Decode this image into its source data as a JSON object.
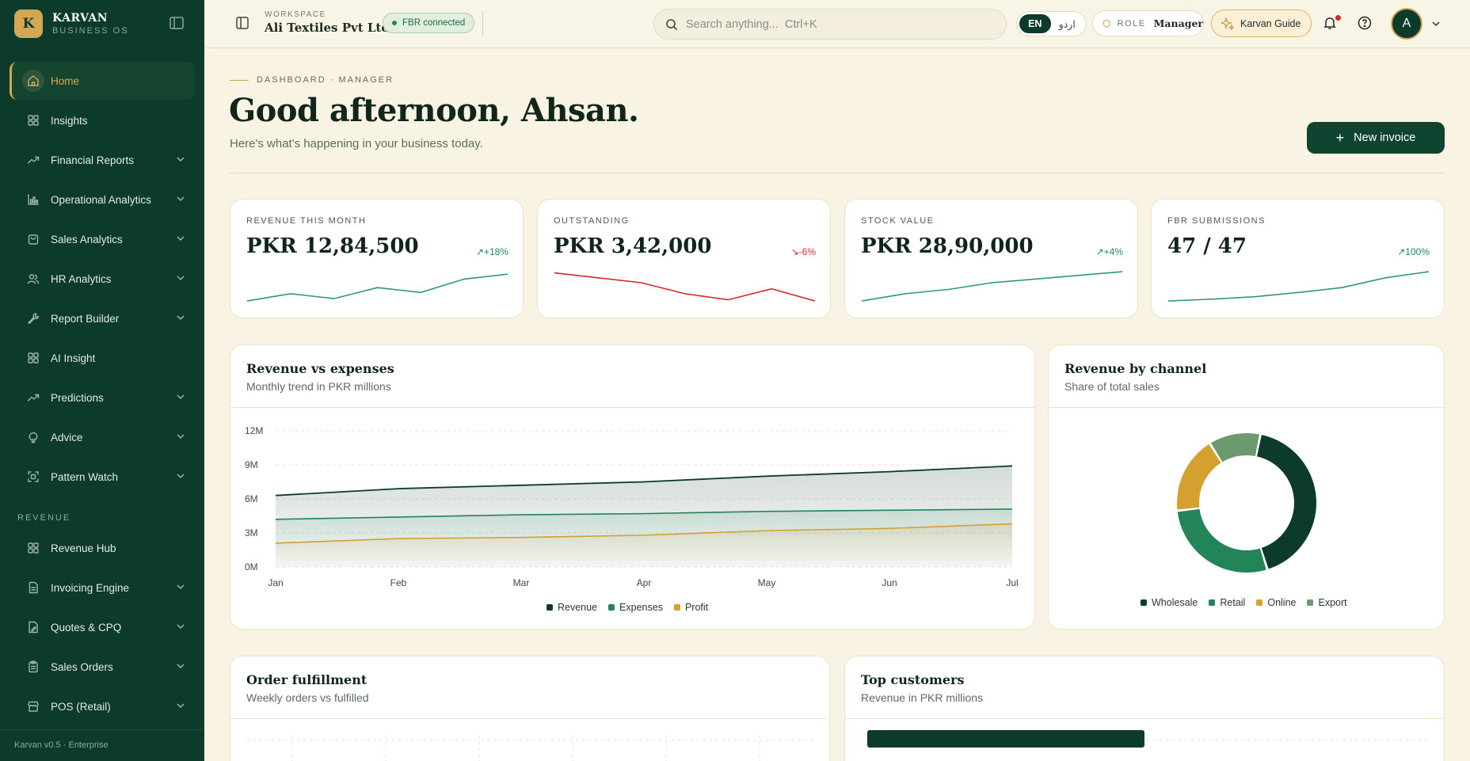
{
  "brand": {
    "logo_letter": "K",
    "name": "KARVAN",
    "subtitle": "BUSINESS OS"
  },
  "sidebar": {
    "items": [
      {
        "label": "Home",
        "icon": "home-icon",
        "active": true
      },
      {
        "label": "Insights",
        "icon": "grid-icon"
      },
      {
        "label": "Financial Reports",
        "icon": "trending-up-icon",
        "expandable": true
      },
      {
        "label": "Operational Analytics",
        "icon": "bar-chart-icon",
        "expandable": true
      },
      {
        "label": "Sales Analytics",
        "icon": "shopping-bag-icon",
        "expandable": true
      },
      {
        "label": "HR Analytics",
        "icon": "users-icon",
        "expandable": true
      },
      {
        "label": "Report Builder",
        "icon": "wrench-icon",
        "expandable": true
      },
      {
        "label": "AI Insight",
        "icon": "grid-icon"
      },
      {
        "label": "Predictions",
        "icon": "trending-up-icon",
        "expandable": true
      },
      {
        "label": "Advice",
        "icon": "lightbulb-icon",
        "expandable": true
      },
      {
        "label": "Pattern Watch",
        "icon": "scan-icon",
        "expandable": true
      }
    ],
    "section_label": "REVENUE",
    "revenue_items": [
      {
        "label": "Revenue Hub",
        "icon": "grid-icon"
      },
      {
        "label": "Invoicing Engine",
        "icon": "document-icon",
        "expandable": true
      },
      {
        "label": "Quotes & CPQ",
        "icon": "document-edit-icon",
        "expandable": true
      },
      {
        "label": "Sales Orders",
        "icon": "clipboard-icon",
        "expandable": true
      },
      {
        "label": "POS (Retail)",
        "icon": "store-icon",
        "expandable": true
      }
    ],
    "footer": "Karvan v0.5 · Enterprise"
  },
  "topbar": {
    "workspace_label": "WORKSPACE",
    "workspace_name": "Ali Textiles Pvt Ltd",
    "fbr_status": "FBR connected",
    "search_placeholder": "Search anything...  Ctrl+K",
    "lang_en": "EN",
    "lang_ur": "اردو",
    "role_label": "ROLE",
    "role_value": "Manager",
    "guide_label": "Karvan Guide",
    "avatar_letter": "A"
  },
  "page": {
    "eyebrow": "DASHBOARD · MANAGER",
    "greeting": "Good afternoon, Ahsan.",
    "subtitle": "Here's what's happening in your business today.",
    "new_invoice": "New invoice"
  },
  "colors": {
    "brand_dark": "#0c3a2b",
    "accent_gold": "#d4a853",
    "positive": "#1f8a55",
    "negative": "#d62828"
  },
  "kpis": [
    {
      "label": "REVENUE THIS MONTH",
      "value": "PKR 12,84,500",
      "delta": "+18%",
      "direction": "up",
      "trend": [
        2,
        3.2,
        2.4,
        4.2,
        3.4,
        5.6,
        6.4
      ]
    },
    {
      "label": "OUTSTANDING",
      "value": "PKR 3,42,000",
      "delta": "-6%",
      "direction": "down",
      "trend": [
        6.6,
        5.8,
        5.0,
        3.2,
        2.2,
        4.0,
        2.0
      ]
    },
    {
      "label": "STOCK VALUE",
      "value": "PKR 28,90,000",
      "delta": "+4%",
      "direction": "up",
      "trend": [
        2,
        3.2,
        3.9,
        5.0,
        5.6,
        6.2,
        6.8
      ]
    },
    {
      "label": "FBR SUBMISSIONS",
      "value": "47 / 47",
      "delta": "100%",
      "direction": "up",
      "trend": [
        2,
        2.3,
        2.7,
        3.4,
        4.2,
        5.8,
        6.8
      ]
    }
  ],
  "revenue_chart": {
    "title": "Revenue vs expenses",
    "subtitle": "Monthly trend in PKR millions",
    "chart_data": {
      "type": "area",
      "categories": [
        "Jan",
        "Feb",
        "Mar",
        "Apr",
        "May",
        "Jun",
        "Jul"
      ],
      "series": [
        {
          "name": "Revenue",
          "color": "#0c3a2b",
          "values": [
            6.3,
            6.9,
            7.2,
            7.5,
            8.0,
            8.4,
            8.9
          ]
        },
        {
          "name": "Expenses",
          "color": "#23845a",
          "values": [
            4.2,
            4.4,
            4.6,
            4.7,
            4.9,
            5.0,
            5.1
          ]
        },
        {
          "name": "Profit",
          "color": "#d4a030",
          "values": [
            2.1,
            2.5,
            2.6,
            2.8,
            3.2,
            3.4,
            3.8
          ]
        }
      ],
      "yticks": [
        "12M",
        "9M",
        "6M",
        "3M",
        "0M"
      ],
      "ylim": [
        0,
        12
      ],
      "grid": true,
      "legend": "bottom"
    }
  },
  "channel_chart": {
    "title": "Revenue by channel",
    "subtitle": "Share of total sales",
    "chart_data": {
      "type": "pie",
      "donut": true,
      "labels": [
        "Wholesale",
        "Retail",
        "Online",
        "Export"
      ],
      "values": [
        42,
        28,
        18,
        12
      ],
      "colors": [
        "#0c3a2b",
        "#23845a",
        "#d4a030",
        "#6a9a6e"
      ],
      "legend": "bottom"
    }
  },
  "fulfillment": {
    "title": "Order fulfillment",
    "subtitle": "Weekly orders vs fulfilled"
  },
  "top_customers": {
    "title": "Top customers",
    "subtitle": "Revenue in PKR millions"
  }
}
